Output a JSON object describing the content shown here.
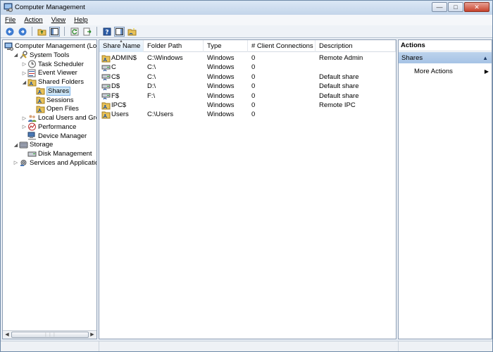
{
  "window": {
    "title": "Computer Management"
  },
  "menu": [
    "File",
    "Action",
    "View",
    "Help"
  ],
  "toolbar": [
    "back-icon",
    "forward-icon",
    "up-folder-icon",
    "show-hide-tree-icon",
    "refresh-icon",
    "export-list-icon",
    "help-icon",
    "show-hide-action-pane-icon",
    "new-share-icon"
  ],
  "tree": [
    {
      "label": "Computer Management (Local",
      "level": 0,
      "expander": "",
      "icon": "computer-icon",
      "name": "computer-management"
    },
    {
      "label": "System Tools",
      "level": 1,
      "expander": "open",
      "icon": "tools-icon",
      "name": "system-tools"
    },
    {
      "label": "Task Scheduler",
      "level": 2,
      "expander": "closed",
      "icon": "clock-icon",
      "name": "task-scheduler"
    },
    {
      "label": "Event Viewer",
      "level": 2,
      "expander": "closed",
      "icon": "event-viewer-icon",
      "name": "event-viewer"
    },
    {
      "label": "Shared Folders",
      "level": 2,
      "expander": "open",
      "icon": "shared-folder-icon",
      "name": "shared-folders"
    },
    {
      "label": "Shares",
      "level": 3,
      "expander": "",
      "icon": "shared-folder-icon",
      "name": "shares",
      "selected": true
    },
    {
      "label": "Sessions",
      "level": 3,
      "expander": "",
      "icon": "shared-folder-icon",
      "name": "sessions"
    },
    {
      "label": "Open Files",
      "level": 3,
      "expander": "",
      "icon": "shared-folder-icon",
      "name": "open-files"
    },
    {
      "label": "Local Users and Groups",
      "level": 2,
      "expander": "closed",
      "icon": "users-icon",
      "name": "local-users-groups"
    },
    {
      "label": "Performance",
      "level": 2,
      "expander": "closed",
      "icon": "performance-icon",
      "name": "performance"
    },
    {
      "label": "Device Manager",
      "level": 2,
      "expander": "",
      "icon": "device-manager-icon",
      "name": "device-manager"
    },
    {
      "label": "Storage",
      "level": 1,
      "expander": "open",
      "icon": "storage-icon",
      "name": "storage"
    },
    {
      "label": "Disk Management",
      "level": 2,
      "expander": "",
      "icon": "disk-icon",
      "name": "disk-management"
    },
    {
      "label": "Services and Applications",
      "level": 1,
      "expander": "closed",
      "icon": "services-icon",
      "name": "services-applications"
    }
  ],
  "columns": [
    "Share Name",
    "Folder Path",
    "Type",
    "# Client Connections",
    "Description"
  ],
  "shares": [
    {
      "name": "ADMIN$",
      "path": "C:\\Windows",
      "type": "Windows",
      "connections": "0",
      "description": "Remote Admin",
      "icon": "shared-folder-icon"
    },
    {
      "name": "C",
      "path": "C:\\",
      "type": "Windows",
      "connections": "0",
      "description": "",
      "icon": "shared-drive-icon"
    },
    {
      "name": "C$",
      "path": "C:\\",
      "type": "Windows",
      "connections": "0",
      "description": "Default share",
      "icon": "shared-drive-icon"
    },
    {
      "name": "D$",
      "path": "D:\\",
      "type": "Windows",
      "connections": "0",
      "description": "Default share",
      "icon": "shared-drive-icon"
    },
    {
      "name": "F$",
      "path": "F:\\",
      "type": "Windows",
      "connections": "0",
      "description": "Default share",
      "icon": "shared-drive-icon"
    },
    {
      "name": "IPC$",
      "path": "",
      "type": "Windows",
      "connections": "0",
      "description": "Remote IPC",
      "icon": "shared-folder-icon"
    },
    {
      "name": "Users",
      "path": "C:\\Users",
      "type": "Windows",
      "connections": "0",
      "description": "",
      "icon": "shared-folder-icon"
    }
  ],
  "actions": {
    "header": "Actions",
    "group": "Shares",
    "items": [
      "More Actions"
    ]
  }
}
